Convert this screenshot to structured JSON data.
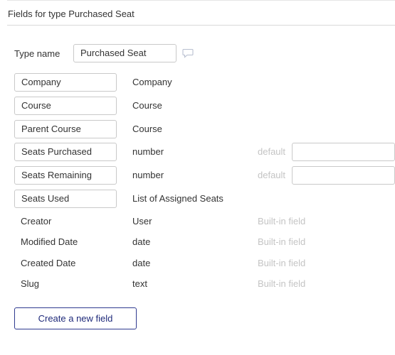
{
  "header": {
    "title": "Fields for type Purchased Seat"
  },
  "type_name": {
    "label": "Type name",
    "value": "Purchased Seat"
  },
  "fields": [
    {
      "name": "Company",
      "type": "Company"
    },
    {
      "name": "Course",
      "type": "Course"
    },
    {
      "name": "Parent Course",
      "type": "Course"
    },
    {
      "name": "Seats Purchased",
      "type": "number",
      "default_label": "default",
      "default_value": ""
    },
    {
      "name": "Seats Remaining",
      "type": "number",
      "default_label": "default",
      "default_value": ""
    },
    {
      "name": "Seats Used",
      "type": "List of Assigned Seats"
    }
  ],
  "builtin_fields": [
    {
      "name": "Creator",
      "type": "User",
      "note": "Built-in field"
    },
    {
      "name": "Modified Date",
      "type": "date",
      "note": "Built-in field"
    },
    {
      "name": "Created Date",
      "type": "date",
      "note": "Built-in field"
    },
    {
      "name": "Slug",
      "type": "text",
      "note": "Built-in field"
    }
  ],
  "actions": {
    "create_label": "Create a new field"
  },
  "icons": {
    "comment": "comment-icon"
  },
  "colors": {
    "accent": "#2f3a8f",
    "muted": "#c4c4c4",
    "border": "#c9c9c9"
  }
}
